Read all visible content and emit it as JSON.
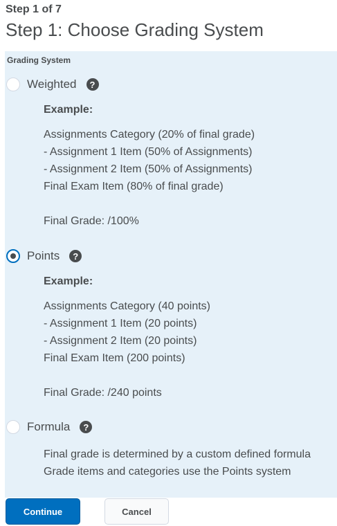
{
  "header": {
    "step_label": "Step 1 of 7",
    "title": "Step 1: Choose Grading System"
  },
  "panel": {
    "label": "Grading System"
  },
  "options": [
    {
      "label": "Weighted",
      "checked": false,
      "example_heading": "Example:",
      "lines": [
        "Assignments Category (20% of final grade)",
        "- Assignment 1 Item (50% of Assignments)",
        "- Assignment 2 Item (50% of Assignments)",
        "Final Exam Item (80% of final grade)"
      ],
      "final": "Final Grade: /100%"
    },
    {
      "label": "Points",
      "checked": true,
      "example_heading": "Example:",
      "lines": [
        "Assignments Category (40 points)",
        "- Assignment 1 Item (20 points)",
        "- Assignment 2 Item (20 points)",
        "Final Exam Item (200 points)"
      ],
      "final": "Final Grade: /240 points"
    },
    {
      "label": "Formula",
      "checked": false,
      "lines": [
        "Final grade is determined by a custom defined formula",
        "Grade items and categories use the Points system"
      ]
    }
  ],
  "help_icon_glyph": "?",
  "buttons": {
    "continue": "Continue",
    "cancel": "Cancel"
  },
  "colors": {
    "panel_bg": "#e6f1f9",
    "primary": "#006fbf",
    "text": "#494c4e"
  }
}
